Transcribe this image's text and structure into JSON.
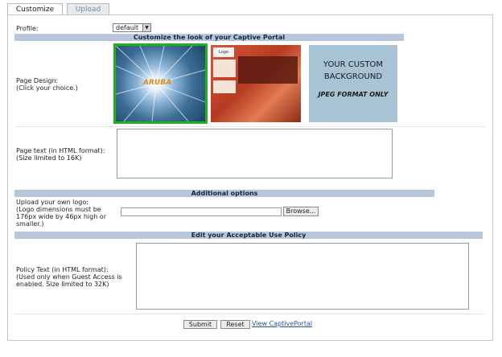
{
  "tabs": [
    {
      "label": "Customize"
    },
    {
      "label": "Upload"
    }
  ],
  "profile": {
    "label": "Profile:",
    "selected": "default"
  },
  "customize_header": "Customize the look of your Captive Portal",
  "page_design": {
    "label_line1": "Page Design:",
    "label_line2": "(Click your choice.)",
    "thumb1_logo": "ARUBA",
    "thumb2_logo": "Logo",
    "custom_line1": "YOUR CUSTOM",
    "custom_line2": "BACKGROUND",
    "custom_line3": "JPEG FORMAT ONLY"
  },
  "page_text": {
    "line1": "Page text (in HTML format):",
    "line2": "(Size limited to 16K)"
  },
  "additional_header": "Additional options",
  "logo_upload": {
    "line1": "Upload your own logo:",
    "line2": "(Logo dimensions must be",
    "line3": "176px wide by 46px high or",
    "line4": "smaller.)",
    "browse_label": "Browse..."
  },
  "aup_header": "Edit your Acceptable Use Policy",
  "policy": {
    "line1": "Policy Text (in HTML format):",
    "line2": "(Used only when Guest Access is",
    "line3": "enabled. Size limited to 32K)"
  },
  "actions": {
    "submit": "Submit",
    "reset": "Reset",
    "view_link": "View CaptivePortal"
  },
  "colors": {
    "section_bar": "#b7c7d9",
    "selected_border": "#22b022",
    "link": "#2a53a8"
  }
}
